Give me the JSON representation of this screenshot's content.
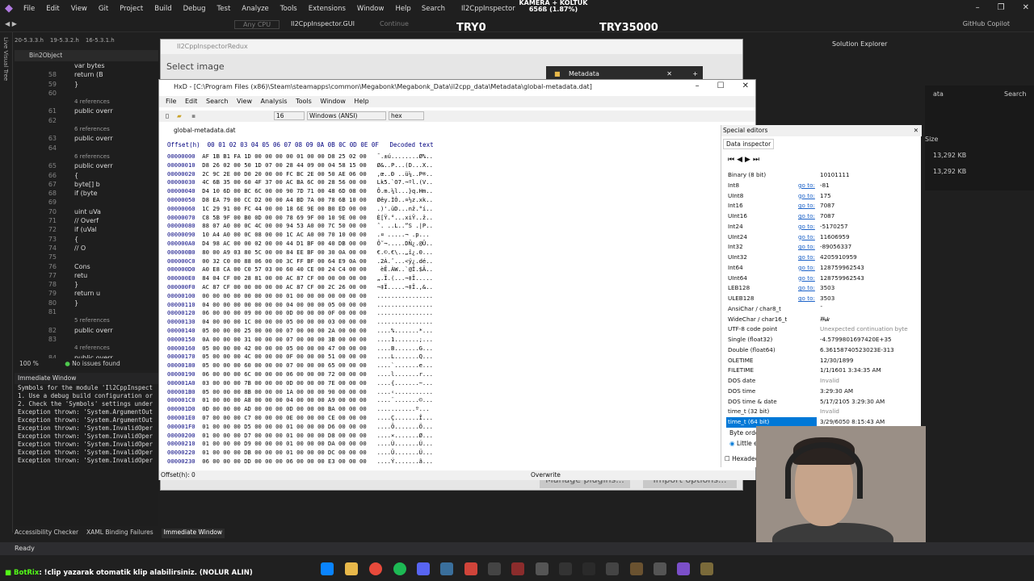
{
  "vs": {
    "menu": [
      "File",
      "Edit",
      "View",
      "Git",
      "Project",
      "Build",
      "Debug",
      "Test",
      "Analyze",
      "Tools",
      "Extensions",
      "Window",
      "Help"
    ],
    "search": "Search",
    "solution_name": "Il2CppInspector",
    "config": "Any CPU",
    "startup": "Il2CppInspector.GUI",
    "continue": "Continue",
    "copilot": "GitHub Copilot",
    "file_tabs": [
      "20-5.3.3.h",
      "19-5.3.2.h",
      "16-5.3.1.h"
    ],
    "object": "Bin2Object",
    "code_lines": [
      {
        "n": "",
        "t": "var bytes"
      },
      {
        "n": "58",
        "t": "return (B"
      },
      {
        "n": "59",
        "t": "}"
      },
      {
        "n": "60",
        "t": ""
      },
      {
        "n": "",
        "t": "4 references"
      },
      {
        "n": "61",
        "t": "public overr"
      },
      {
        "n": "62",
        "t": ""
      },
      {
        "n": "",
        "t": "6 references"
      },
      {
        "n": "63",
        "t": "public overr"
      },
      {
        "n": "64",
        "t": ""
      },
      {
        "n": "",
        "t": "6 references"
      },
      {
        "n": "65",
        "t": "public overr"
      },
      {
        "n": "66",
        "t": "{"
      },
      {
        "n": "67",
        "t": "byte[] b"
      },
      {
        "n": "68",
        "t": "if (byte"
      },
      {
        "n": "69",
        "t": ""
      },
      {
        "n": "70",
        "t": "uint uVa"
      },
      {
        "n": "71",
        "t": "// Overf"
      },
      {
        "n": "72",
        "t": "if (uVal"
      },
      {
        "n": "73",
        "t": "{"
      },
      {
        "n": "74",
        "t": "// O"
      },
      {
        "n": "75",
        "t": ""
      },
      {
        "n": "76",
        "t": "Cons"
      },
      {
        "n": "77",
        "t": "retu"
      },
      {
        "n": "78",
        "t": "}"
      },
      {
        "n": "79",
        "t": "return u"
      },
      {
        "n": "80",
        "t": "}"
      },
      {
        "n": "81",
        "t": ""
      },
      {
        "n": "",
        "t": "5 references"
      },
      {
        "n": "82",
        "t": "public overr"
      },
      {
        "n": "83",
        "t": ""
      },
      {
        "n": "",
        "t": "4 references"
      },
      {
        "n": "84",
        "t": "public overr"
      }
    ],
    "zoom": "100 %",
    "issues": "No issues found",
    "immediate_title": "Immediate Window",
    "immediate_lines": [
      "Symbols for the module 'Il2CppInspect",
      "",
      "1. Use a debug build configuration or",
      "2. Check the 'Symbols' settings under",
      "Exception thrown: 'System.ArgumentOut",
      "Exception thrown: 'System.ArgumentOut",
      "Exception thrown: 'System.InvalidOper",
      "Exception thrown: 'System.InvalidOper",
      "Exception thrown: 'System.InvalidOper",
      "Exception thrown: 'System.InvalidOper",
      "Exception thrown: 'System.InvalidOper"
    ],
    "bottom_tabs": [
      "Accessibility Checker",
      "XAML Binding Failures",
      "Immediate Window"
    ],
    "status": "Ready",
    "solution_explorer": "Solution Explorer",
    "explorer_partial": [
      "ata",
      "Search"
    ],
    "explorer_size_label": "Size",
    "explorer_sizes": [
      "13,292 KB",
      "13,292 KB"
    ]
  },
  "overlay": {
    "camera_label": "KAMERA + KOLTUK",
    "camera_progress": "656ß (1.87%)",
    "left_code": "TRY0",
    "right_code": "TRY35000"
  },
  "il2cpp": {
    "title": "Il2CppInspectorRedux",
    "select_image": "Select image",
    "metadata_tab": "Metadata",
    "manage_plugins": "Manage plugins...",
    "import_options": "Import options..."
  },
  "hxd": {
    "title": "HxD - [C:\\Program Files (x86)\\Steam\\steamapps\\common\\Megabonk\\Megabonk_Data\\il2cpp_data\\Metadata\\global-metadata.dat]",
    "menu": [
      "File",
      "Edit",
      "Search",
      "View",
      "Analysis",
      "Tools",
      "Window",
      "Help"
    ],
    "bytes_per_row": "16",
    "encoding": "Windows (ANSI)",
    "display": "hex",
    "tab": "global-metadata.dat",
    "header": "Offset(h)  00 01 02 03 04 05 06 07 08 09 0A 0B 0C 0D 0E 0F   Decoded text",
    "rows": [
      {
        "o": "00000000",
        "h": "AF 1B B1 FA 1D 00 00 00 00 01 00 00 D8 25 02 00",
        "d": "¯.±ú........Ø%.."
      },
      {
        "o": "00000010",
        "h": "D8 26 02 00 50 1D 07 00 28 44 09 00 04 58 15 00",
        "d": "Ø&..P...(D...X.."
      },
      {
        "o": "00000020",
        "h": "2C 9C 2E 00 D0 20 00 00 FC BC 2E 00 50 AE 06 00",
        "d": ",œ..Ð ..ü¼..P®.."
      },
      {
        "o": "00000030",
        "h": "4C 6B 35 00 60 4F 37 00 AC BA 6C 00 28 56 00 00",
        "d": "Lk5.`O7.¬ºl.(V.."
      },
      {
        "o": "00000040",
        "h": "D4 10 6D 00 BC 6C 00 00 90 7D 71 00 48 6D 08 00",
        "d": "Ô.m.¼l...}q.Hm.."
      },
      {
        "o": "00000050",
        "h": "D8 EA 79 00 CC D2 00 00 A4 BD 7A 00 78 6B 10 00",
        "d": "Øêy.ÌÒ..¤½z.xk.."
      },
      {
        "o": "00000060",
        "h": "1C 29 91 00 FC 44 00 00 18 6E 9E 00 B0 ED 00 00",
        "d": ".)'.üD...nž.°í.."
      },
      {
        "o": "00000070",
        "h": "C8 5B 9F 00 B0 0D 00 00 78 69 9F 00 10 9E 00 00",
        "d": "È[Ÿ.°...xiŸ..ž.."
      },
      {
        "o": "00000080",
        "h": "88 07 A0 00 0C 4C 00 00 94 53 A0 00 7C 50 00 00",
        "d": "ˆ. ..L..”S .|P.."
      },
      {
        "o": "00000090",
        "h": "10 A4 A0 00 0C 08 00 00 1C AC A0 00 70 10 00 00",
        "d": ".¤ .....¬ .p..."
      },
      {
        "o": "000000A0",
        "h": "D4 98 AC 00 00 02 00 00 44 D1 BF 00 40 DB 00 00",
        "d": "Ô˜¬.....DÑ¿.@Û.."
      },
      {
        "o": "000000B0",
        "h": "80 00 A9 03 80 5C 00 00 84 EE BF 00 30 0A 00 00",
        "d": "€.©.€\\..„î¿.0..."
      },
      {
        "o": "000000C0",
        "h": "00 32 C0 00 88 06 00 00 3C FF BF 00 64 E9 0A 00",
        "d": ".2À.ˆ...<ÿ¿.dé.."
      },
      {
        "o": "000000D0",
        "h": "A0 E8 CA 00 C0 57 03 00 60 40 CE 00 24 C4 00 00",
        "d": " èÊ.ÀW..`@Î.$Ä.."
      },
      {
        "o": "000000E0",
        "h": "84 04 CF 00 28 81 00 00 AC 87 CF 00 00 00 00 00",
        "d": "„.Ï.(...¬‡Ï....."
      },
      {
        "o": "000000F0",
        "h": "AC 87 CF 00 00 00 00 00 AC 87 CF 00 2C 26 00 00",
        "d": "¬‡Ï.....¬‡Ï.,&.."
      },
      {
        "o": "00000100",
        "h": "00 00 00 00 00 00 00 00 01 00 00 00 00 00 00 00",
        "d": "................"
      },
      {
        "o": "00000110",
        "h": "04 00 00 00 00 00 00 00 04 00 00 00 05 00 00 00",
        "d": "................"
      },
      {
        "o": "00000120",
        "h": "06 00 00 00 09 00 00 00 0D 00 00 00 0F 00 00 00",
        "d": "................"
      },
      {
        "o": "00000130",
        "h": "04 00 00 00 1C 00 00 00 05 00 00 00 03 00 00 00",
        "d": "................"
      },
      {
        "o": "00000140",
        "h": "05 00 00 00 25 00 00 00 07 00 00 00 2A 00 00 00",
        "d": "....%.......*..."
      },
      {
        "o": "00000150",
        "h": "0A 00 00 00 31 00 00 00 07 00 00 00 3B 00 00 00",
        "d": "....1.......;..."
      },
      {
        "o": "00000160",
        "h": "05 00 00 00 42 00 00 00 05 00 00 00 47 00 00 00",
        "d": "....B.......G..."
      },
      {
        "o": "00000170",
        "h": "05 00 00 00 4C 00 00 00 0F 00 00 00 51 00 00 00",
        "d": "....L.......Q..."
      },
      {
        "o": "00000180",
        "h": "05 00 00 00 60 00 00 00 07 00 00 00 65 00 00 00",
        "d": "....`.......e..."
      },
      {
        "o": "00000190",
        "h": "06 00 00 00 6C 00 00 00 06 00 00 00 72 00 00 00",
        "d": "....l.......r..."
      },
      {
        "o": "000001A0",
        "h": "03 00 00 00 7B 00 00 00 0D 00 00 00 7E 00 00 00",
        "d": "....{.......~..."
      },
      {
        "o": "000001B0",
        "h": "05 00 00 00 8B 00 00 00 1A 00 00 00 90 00 00 00",
        "d": "....‹..........."
      },
      {
        "o": "000001C0",
        "h": "01 00 00 00 A8 00 00 00 04 00 00 00 A9 00 00 00",
        "d": "....¨.......©..."
      },
      {
        "o": "000001D0",
        "h": "0D 00 00 00 AD 00 00 00 0D 00 00 00 BA 00 00 00",
        "d": "....­.......º..."
      },
      {
        "o": "000001E0",
        "h": "07 00 00 00 C7 00 00 00 0E 00 00 00 CE 00 00 00",
        "d": "....Ç.......Î..."
      },
      {
        "o": "000001F0",
        "h": "01 00 00 00 D5 00 00 00 01 00 00 00 D6 00 00 00",
        "d": "....Õ.......Ö..."
      },
      {
        "o": "00000200",
        "h": "01 00 00 00 D7 00 00 00 01 00 00 00 D8 00 00 00",
        "d": "....×.......Ø..."
      },
      {
        "o": "00000210",
        "h": "01 00 00 00 D9 00 00 00 01 00 00 00 DA 00 00 00",
        "d": "....Ù.......Ú..."
      },
      {
        "o": "00000220",
        "h": "01 00 00 00 DB 00 00 00 01 00 00 00 DC 00 00 00",
        "d": "....Û.......Ü..."
      },
      {
        "o": "00000230",
        "h": "06 00 00 00 DD 00 00 00 06 00 00 00 E3 00 00 00",
        "d": "....Ý.......ã..."
      }
    ],
    "status_offset": "Offset(h): 0",
    "status_mode": "Overwrite",
    "special_editors": "Special editors",
    "data_inspector": "Data inspector",
    "inspector": [
      {
        "n": "Binary (8 bit)",
        "g": "",
        "v": "10101111"
      },
      {
        "n": "Int8",
        "g": "go to:",
        "v": "-81"
      },
      {
        "n": "UInt8",
        "g": "go to:",
        "v": "175"
      },
      {
        "n": "Int16",
        "g": "go to:",
        "v": "7087"
      },
      {
        "n": "UInt16",
        "g": "go to:",
        "v": "7087"
      },
      {
        "n": "Int24",
        "g": "go to:",
        "v": "-5170257"
      },
      {
        "n": "UInt24",
        "g": "go to:",
        "v": "11606959"
      },
      {
        "n": "Int32",
        "g": "go to:",
        "v": "-89056337"
      },
      {
        "n": "UInt32",
        "g": "go to:",
        "v": "4205910959"
      },
      {
        "n": "Int64",
        "g": "go to:",
        "v": "128759962543"
      },
      {
        "n": "UInt64",
        "g": "go to:",
        "v": "128759962543"
      },
      {
        "n": "LEB128",
        "g": "go to:",
        "v": "3503"
      },
      {
        "n": "ULEB128",
        "g": "go to:",
        "v": "3503"
      },
      {
        "n": "AnsiChar / char8_t",
        "g": "",
        "v": "¯"
      },
      {
        "n": "WideChar / char16_t",
        "g": "",
        "v": "ᮯ"
      },
      {
        "n": "UTF-8 code point",
        "g": "",
        "v": "Unexpected continuation byte"
      },
      {
        "n": "Single (float32)",
        "g": "",
        "v": "-4.5799801697420E+35"
      },
      {
        "n": "Double (float64)",
        "g": "",
        "v": "6.36158740523023E-313"
      },
      {
        "n": "OLETIME",
        "g": "",
        "v": "12/30/1899"
      },
      {
        "n": "FILETIME",
        "g": "",
        "v": "1/1/1601 3:34:35 AM"
      },
      {
        "n": "DOS date",
        "g": "",
        "v": "Invalid"
      },
      {
        "n": "DOS time",
        "g": "",
        "v": "3:29:30 AM"
      },
      {
        "n": "DOS time & date",
        "g": "",
        "v": "5/17/2105 3:29:30 AM"
      },
      {
        "n": "time_t (32 bit)",
        "g": "",
        "v": "Invalid"
      },
      {
        "n": "time_t (64 bit)",
        "g": "",
        "v": "3/29/6050 8:15:43 AM"
      }
    ],
    "byte_order": "Byte orde",
    "little_endian": "Little e",
    "hexadecimal": "Hexadec"
  },
  "taskbar": {
    "message_user": "BotRix",
    "message_text": ": !clip yazarak otomatik klip alabilirsiniz. (NOLUR ALIN)"
  }
}
